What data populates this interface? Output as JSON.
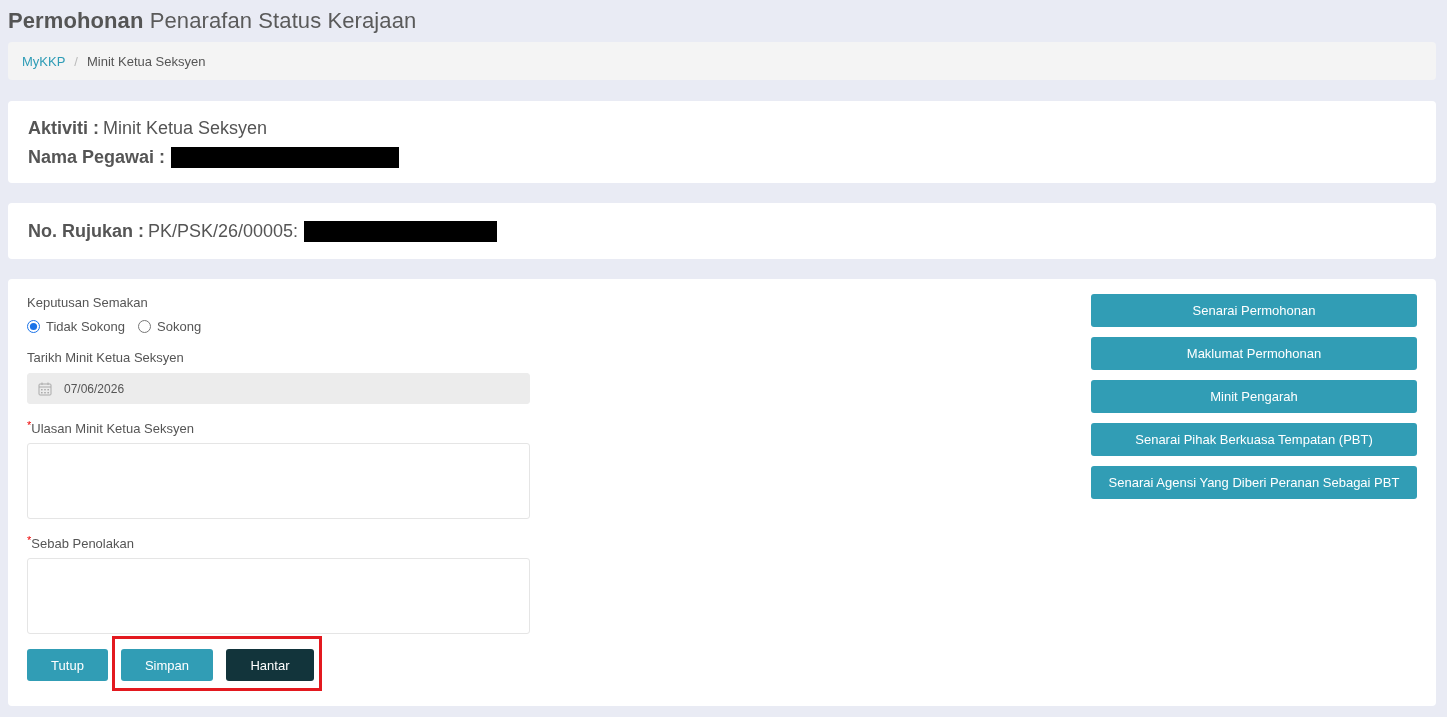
{
  "page_title": "**Permohonan** Penarafan Status Kerajaan",
  "breadcrumb": {
    "separator": "/",
    "items": [
      {
        "label": "MyKKP",
        "kind": "link"
      },
      {
        "label": "Minit Ketua Seksyen",
        "kind": "current"
      }
    ]
  },
  "activity_card": {
    "fields": [
      {
        "label": "Aktiviti :",
        "value": "Minit Ketua Seksyen",
        "redacted": false
      },
      {
        "label": "Nama Pegawai :",
        "redacted": true
      }
    ]
  },
  "reference_card": {
    "fields": [
      {
        "label": "No. Rujukan :",
        "value": "PK/PSK/26/00005:",
        "redacted": true
      }
    ]
  },
  "form": {
    "required_mark": "*",
    "decision": {
      "label": "Keputusan Semakan",
      "options": [
        {
          "label": "Tidak Sokong",
          "selected": true
        },
        {
          "label": "Sokong",
          "selected": false
        }
      ]
    },
    "date": {
      "label": "Tarikh Minit Ketua Seksyen",
      "value": "07/06/2026",
      "disabled": true
    },
    "textareas": [
      {
        "label": "Ulasan Minit Ketua Seksyen",
        "required": true
      },
      {
        "label": "Sebab Penolakan",
        "required": true
      }
    ],
    "buttons": [
      {
        "label": "Tutup",
        "kind": "primary",
        "highlighted": false
      },
      {
        "label": "Simpan",
        "kind": "primary",
        "highlighted": true
      },
      {
        "label": "Hantar",
        "kind": "dark",
        "highlighted": true
      }
    ]
  },
  "side_buttons": [
    {
      "label": "Senarai Permohonan"
    },
    {
      "label": "Maklumat Permohonan"
    },
    {
      "label": "Minit Pengarah"
    },
    {
      "label": "Senarai Pihak Berkuasa Tempatan (PBT)"
    },
    {
      "label": "Senarai Agensi Yang Diberi Peranan Sebagai PBT"
    }
  ]
}
